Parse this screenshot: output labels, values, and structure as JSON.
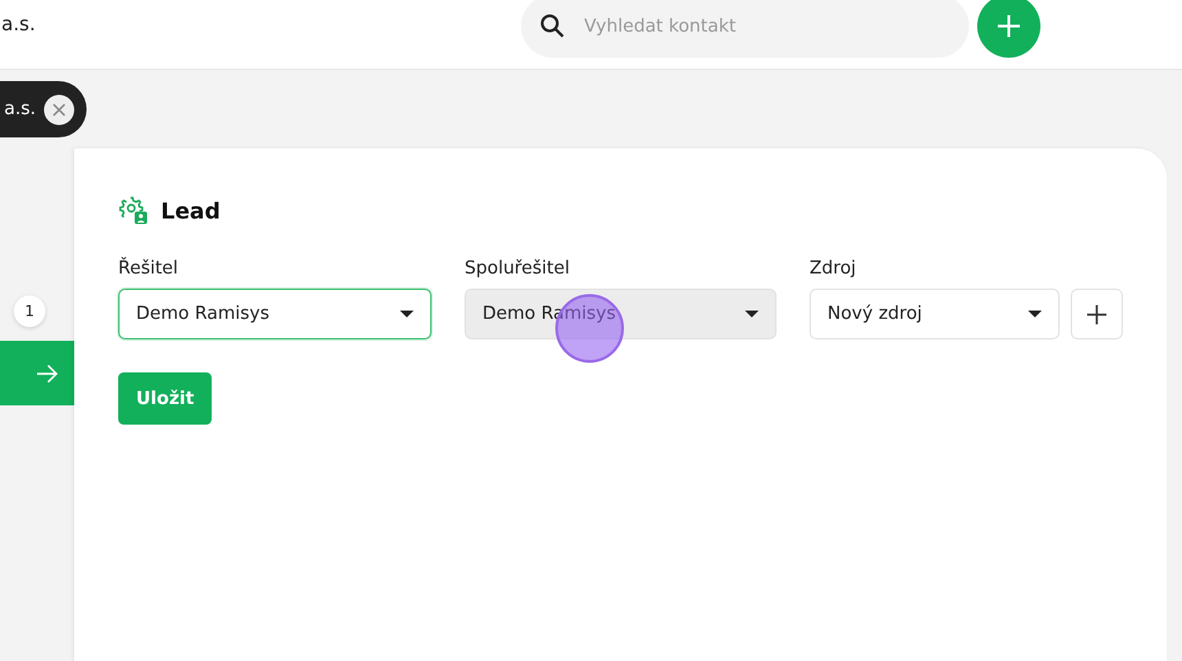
{
  "header": {
    "company": "a.s.",
    "search": {
      "placeholder": "Vyhledat kontakt"
    }
  },
  "filter_chip": {
    "label": "a.s."
  },
  "sidebar": {
    "badge": "1"
  },
  "card": {
    "title": "Lead",
    "fields": [
      {
        "label": "Řešitel",
        "value": "Demo Ramisys",
        "focused": true,
        "hovered": false,
        "add_button": false
      },
      {
        "label": "Spoluřešitel",
        "value": "Demo Ramisys",
        "focused": false,
        "hovered": true,
        "add_button": false
      },
      {
        "label": "Zdroj",
        "value": "Nový zdroj",
        "focused": false,
        "hovered": false,
        "add_button": true
      }
    ],
    "save_button": "Uložit"
  }
}
